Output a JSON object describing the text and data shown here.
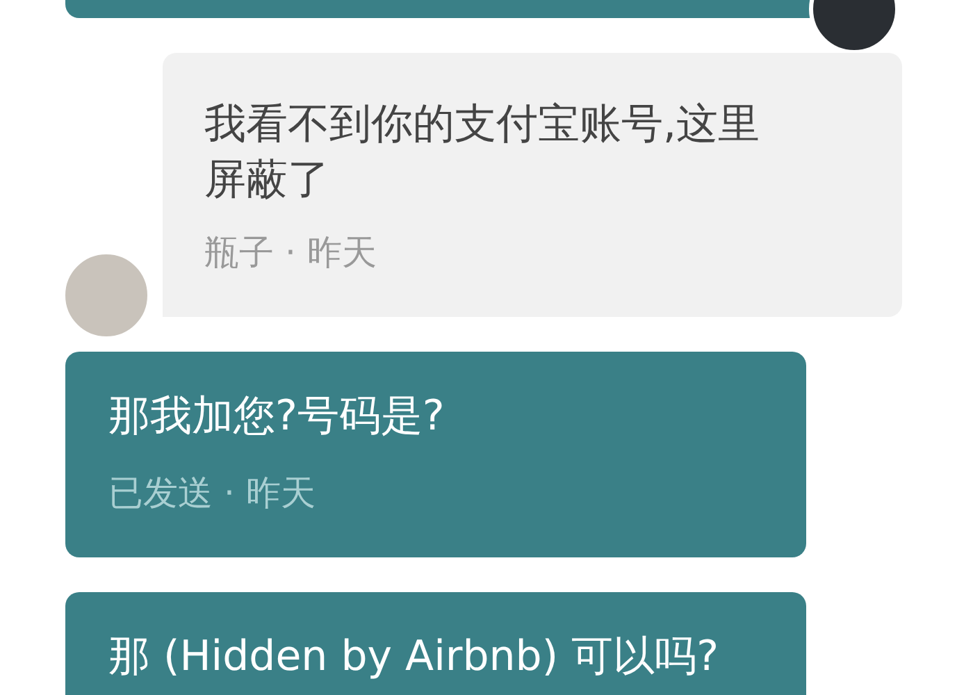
{
  "messages": [
    {
      "kind": "sent",
      "avatar": true
    },
    {
      "kind": "received",
      "avatar": true,
      "text": "我看不到你的支付宝账号,这里屏蔽了",
      "meta": "瓶子 · 昨天"
    },
    {
      "kind": "sent",
      "avatar": false,
      "text": "那我加您?号码是?",
      "meta": "已发送 · 昨天"
    },
    {
      "kind": "sent",
      "avatar": false,
      "text": "那 (Hidden by Airbnb) 可以吗?"
    }
  ]
}
